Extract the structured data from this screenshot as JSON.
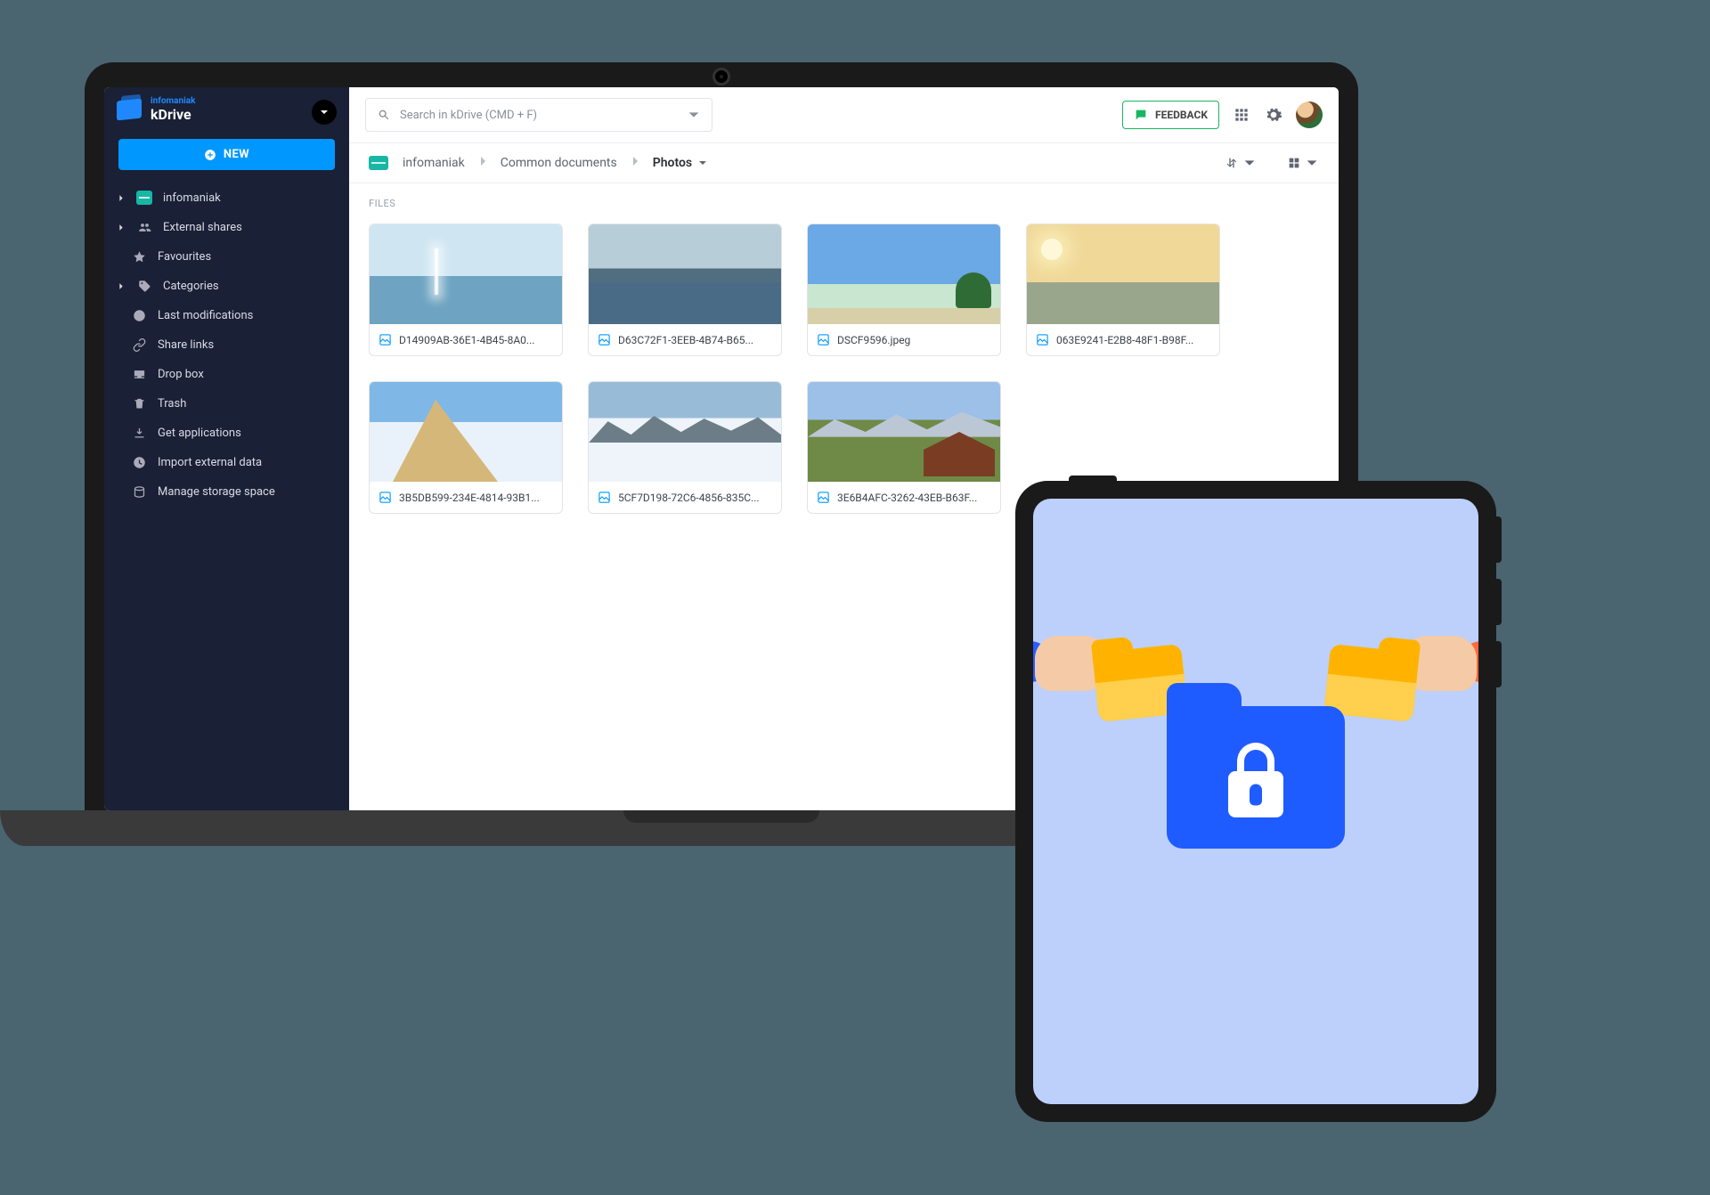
{
  "brand": {
    "top": "infomaniak",
    "name": "kDrive"
  },
  "sidebar": {
    "new_label": "NEW",
    "items": [
      {
        "label": "infomaniak"
      },
      {
        "label": "External shares"
      },
      {
        "label": "Favourites"
      },
      {
        "label": "Categories"
      },
      {
        "label": "Last modifications"
      },
      {
        "label": "Share links"
      },
      {
        "label": "Drop box"
      },
      {
        "label": "Trash"
      },
      {
        "label": "Get applications"
      },
      {
        "label": "Import external data"
      },
      {
        "label": "Manage storage space"
      }
    ]
  },
  "topbar": {
    "search_placeholder": "Search in kDrive (CMD + F)",
    "feedback_label": "FEEDBACK"
  },
  "breadcrumb": {
    "root": "infomaniak",
    "mid": "Common documents",
    "current": "Photos"
  },
  "section_label": "FILES",
  "files": [
    {
      "name": "D14909AB-36E1-4B45-8A0..."
    },
    {
      "name": "D63C72F1-3EEB-4B74-B65..."
    },
    {
      "name": "DSCF9596.jpeg"
    },
    {
      "name": "063E9241-E2B8-48F1-B98F..."
    },
    {
      "name": "3B5DB599-234E-4814-93B1..."
    },
    {
      "name": "5CF7D198-72C6-4856-835C..."
    },
    {
      "name": "3E6B4AFC-3262-43EB-B63F..."
    }
  ]
}
